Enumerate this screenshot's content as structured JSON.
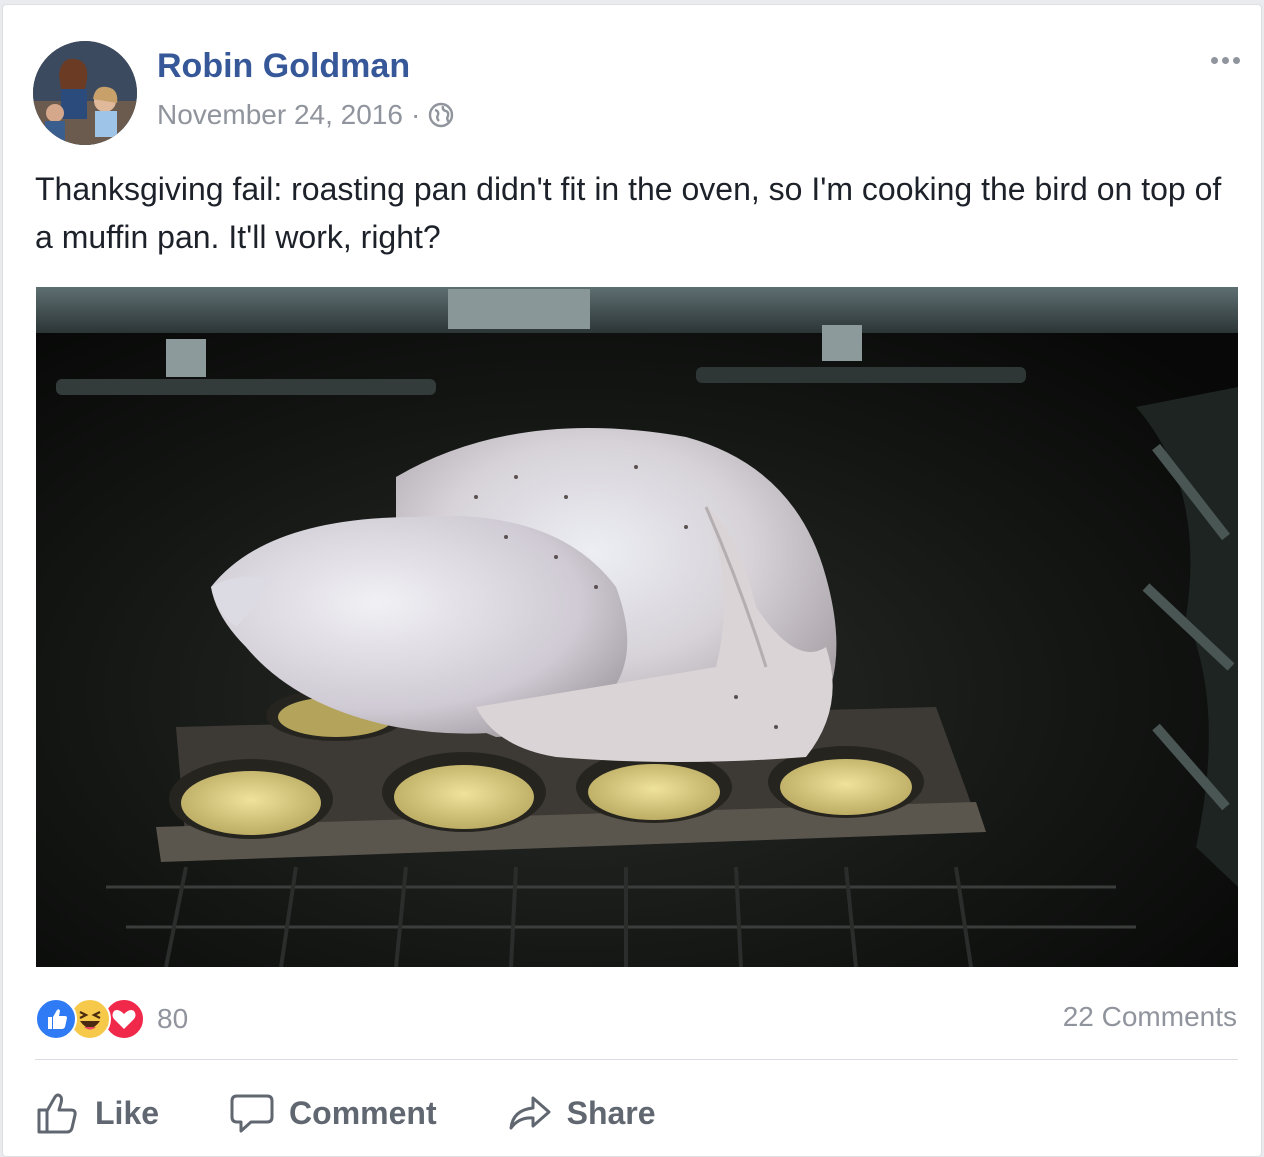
{
  "post": {
    "author": "Robin Goldman",
    "date": "November 24, 2016",
    "separator": "·",
    "privacy_icon": "globe-icon",
    "text": "Thanksgiving fail: roasting pan didn't fit in the oven, so I'm cooking the bird on top of a muffin pan. It'll work, right?",
    "more_icon": "more-options-icon"
  },
  "photo": {
    "subject": "turkey-on-muffin-pan-in-oven"
  },
  "reactions": {
    "icons": [
      "like-reaction-icon",
      "haha-reaction-icon",
      "love-reaction-icon"
    ],
    "count": "80",
    "comments": "22 Comments"
  },
  "actions": {
    "like": "Like",
    "comment": "Comment",
    "share": "Share"
  },
  "colors": {
    "author_link": "#365899",
    "meta_text": "#90949c",
    "like_blue": "#2f7bf5",
    "haha_yellow": "#f7c94a",
    "love_red": "#f0284a"
  }
}
